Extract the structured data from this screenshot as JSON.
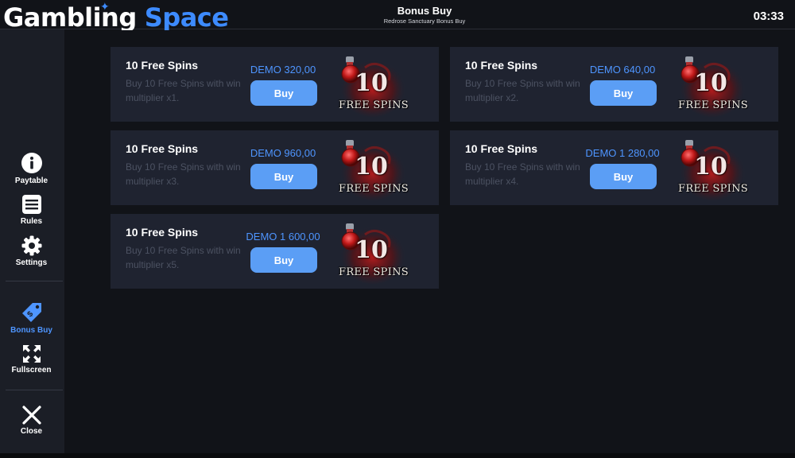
{
  "header": {
    "logo_word1": "Gambling",
    "logo_word2": "Space",
    "title": "Bonus Buy",
    "subtitle": "Redrose Sanctuary Bonus Buy",
    "clock": "03:33"
  },
  "sidebar": {
    "items": [
      {
        "label": "Paytable",
        "icon": "info-icon"
      },
      {
        "label": "Rules",
        "icon": "list-icon"
      },
      {
        "label": "Settings",
        "icon": "gear-icon"
      },
      {
        "label": "Bonus Buy",
        "icon": "tag-icon",
        "active": true
      },
      {
        "label": "Fullscreen",
        "icon": "fullscreen-icon"
      },
      {
        "label": "Close",
        "icon": "close-icon"
      }
    ]
  },
  "cards": [
    {
      "title": "10 Free Spins",
      "desc": "Buy 10 Free Spins with win multiplier x1.",
      "price": "DEMO 320,00",
      "button": "Buy",
      "art_number": "10",
      "art_text": "FREE SPINS"
    },
    {
      "title": "10 Free Spins",
      "desc": "Buy 10 Free Spins with win multiplier x2.",
      "price": "DEMO 640,00",
      "button": "Buy",
      "art_number": "10",
      "art_text": "FREE SPINS"
    },
    {
      "title": "10 Free Spins",
      "desc": "Buy 10 Free Spins with win multiplier x3.",
      "price": "DEMO 960,00",
      "button": "Buy",
      "art_number": "10",
      "art_text": "FREE SPINS"
    },
    {
      "title": "10 Free Spins",
      "desc": "Buy 10 Free Spins with win multiplier x4.",
      "price": "DEMO 1 280,00",
      "button": "Buy",
      "art_number": "10",
      "art_text": "FREE SPINS"
    },
    {
      "title": "10 Free Spins",
      "desc": "Buy 10 Free Spins with win multiplier x5.",
      "price": "DEMO 1 600,00",
      "button": "Buy",
      "art_number": "10",
      "art_text": "FREE SPINS"
    }
  ],
  "colors": {
    "accent": "#4e95ff",
    "button": "#5b9ef5",
    "card_bg": "#1f2330",
    "sidebar_bg": "#1b1e26",
    "page_bg": "#111318"
  }
}
